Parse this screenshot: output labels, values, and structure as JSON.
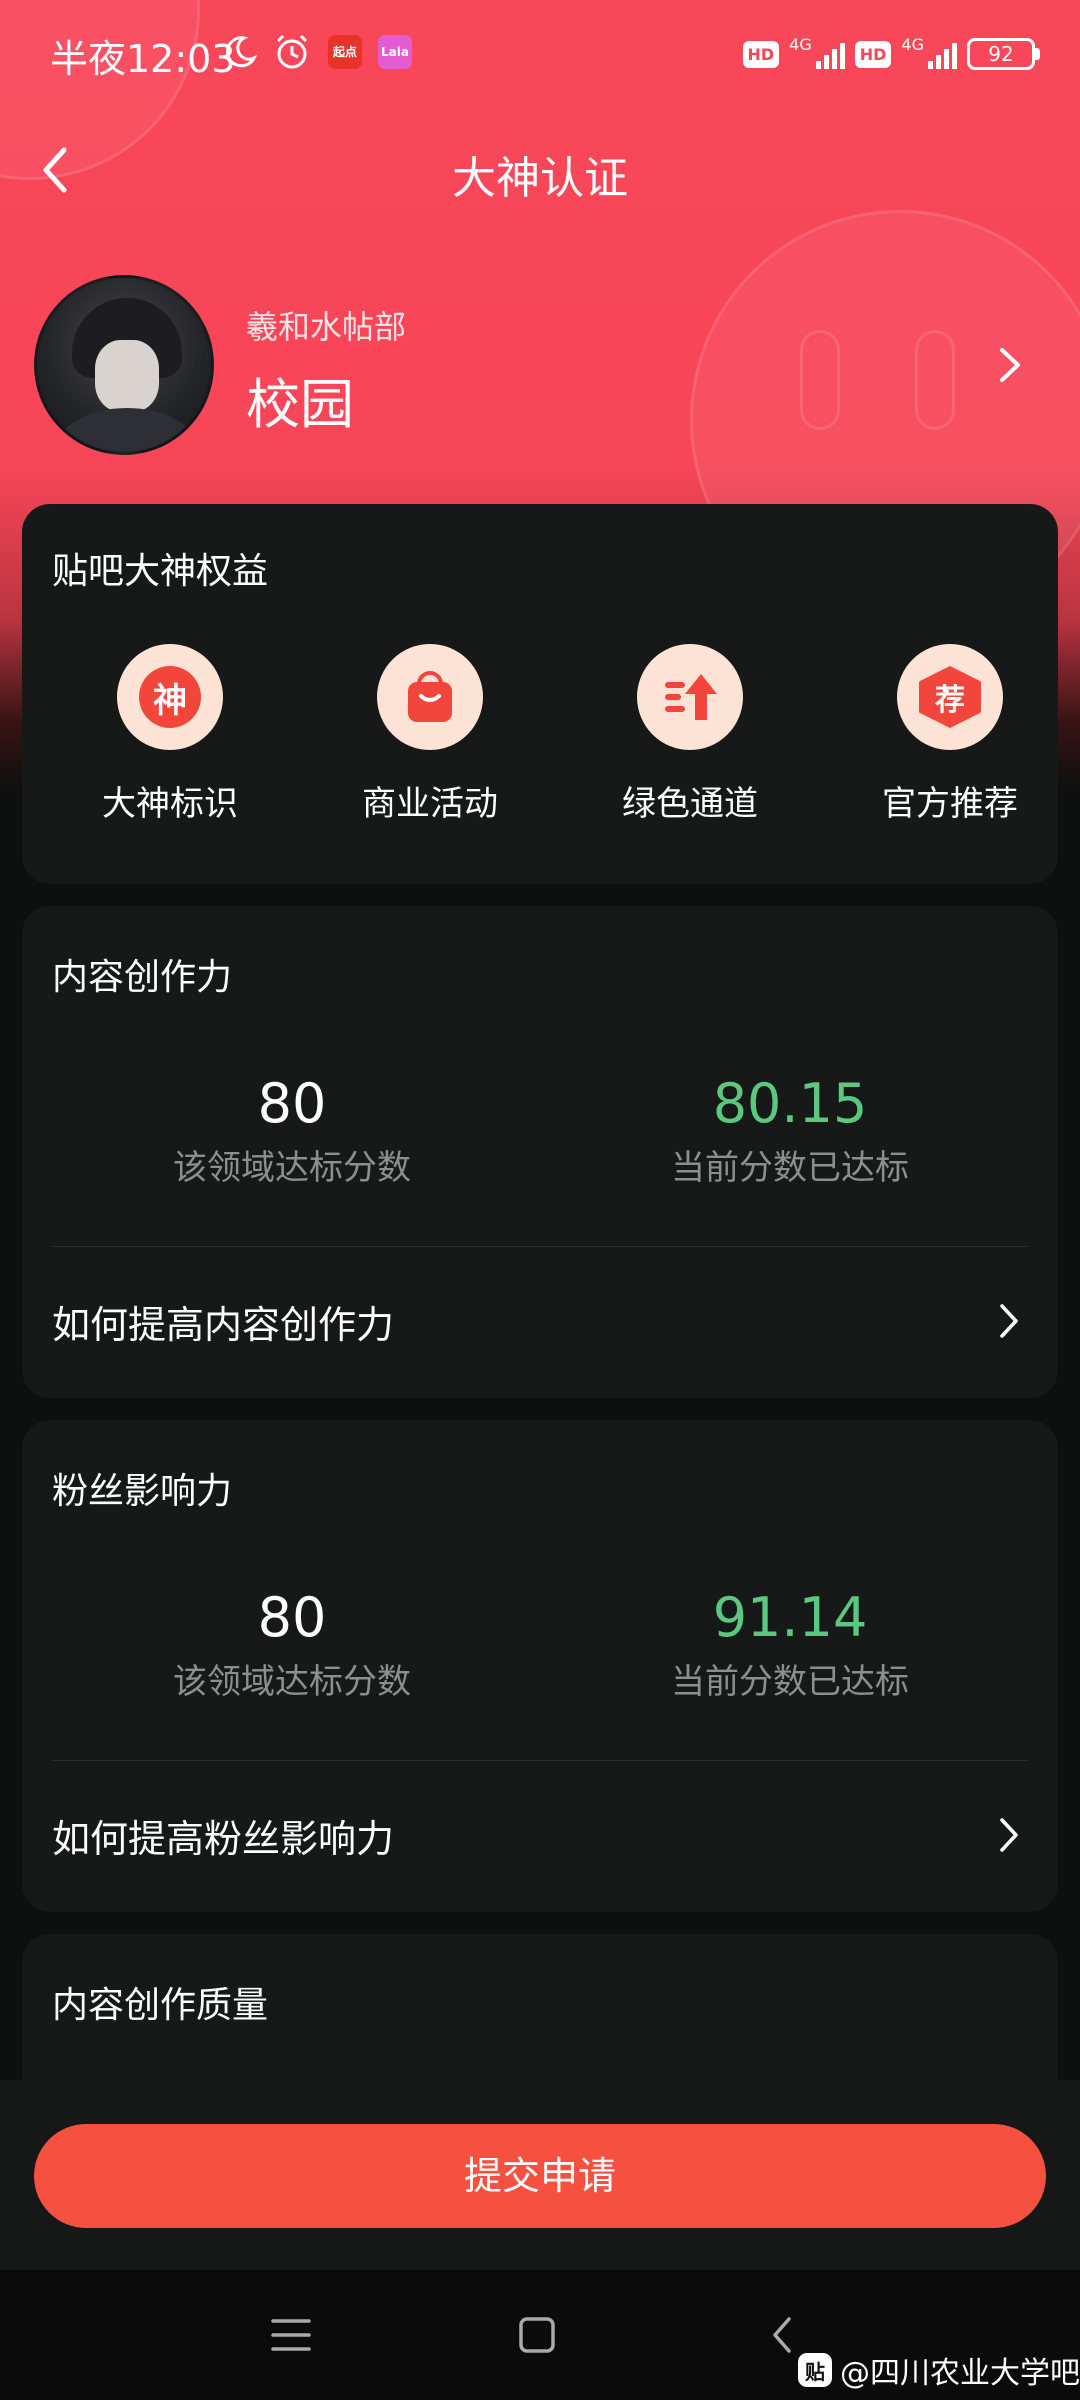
{
  "status_bar": {
    "time": "半夜12:03",
    "app_badge_1": "起点",
    "app_badge_2": "Lala",
    "hd_1": "HD",
    "net_1": "4G",
    "hd_2": "HD",
    "net_2": "4G",
    "battery": "92"
  },
  "header": {
    "title": "大神认证"
  },
  "profile": {
    "forum": "羲和水帖部",
    "name": "校园"
  },
  "benefits": {
    "title": "贴吧大神权益",
    "items": [
      {
        "icon": "shen-icon",
        "glyph": "神",
        "label": "大神标识"
      },
      {
        "icon": "shopping-bag-icon",
        "glyph": "",
        "label": "商业活动"
      },
      {
        "icon": "fast-track-icon",
        "glyph": "",
        "label": "绿色通道"
      },
      {
        "icon": "recommend-icon",
        "glyph": "荐",
        "label": "官方推荐"
      }
    ]
  },
  "content_creation": {
    "title": "内容创作力",
    "threshold": "80",
    "threshold_label": "该领域达标分数",
    "current": "80.15",
    "current_label": "当前分数已达标",
    "link": "如何提高内容创作力"
  },
  "fan_influence": {
    "title": "粉丝影响力",
    "threshold": "80",
    "threshold_label": "该领域达标分数",
    "current": "91.14",
    "current_label": "当前分数已达标",
    "link": "如何提高粉丝影响力"
  },
  "content_quality": {
    "title": "内容创作质量"
  },
  "actions": {
    "submit": "提交申请"
  },
  "watermark": {
    "icon_glyph": "贴",
    "text": "@四川农业大学吧"
  },
  "colors": {
    "hero": "#f74658",
    "accent": "#f65140",
    "pass_green": "#5cc77f",
    "card": "#171918"
  }
}
